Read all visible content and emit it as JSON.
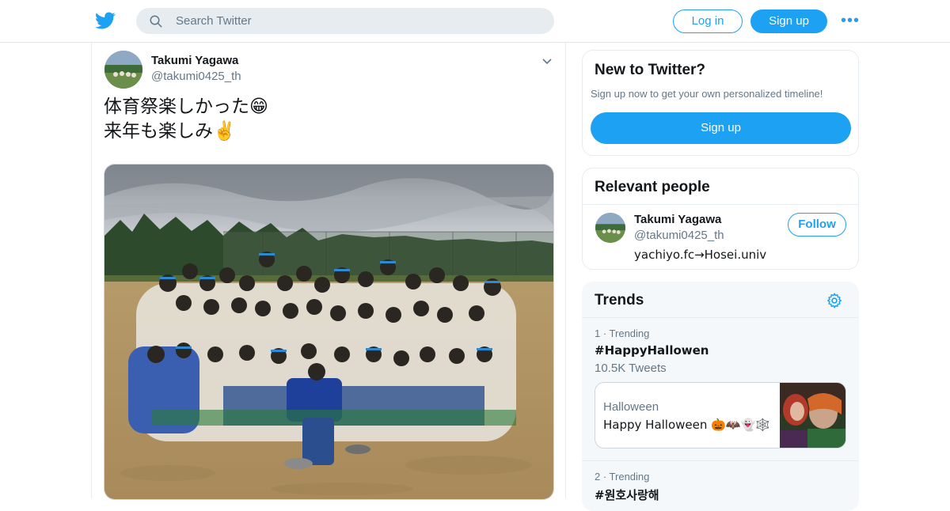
{
  "header": {
    "search_placeholder": "Search Twitter",
    "login_label": "Log in",
    "signup_label": "Sign up",
    "more_label": "•••",
    "brand_color": "#1da1f2"
  },
  "tweet": {
    "author_name": "Takumi Yagawa",
    "author_handle": "@takumi0425_th",
    "text_line1": "体育祭楽しかった😁",
    "text_line2": "来年も楽しみ✌️"
  },
  "sidebar": {
    "new_to_twitter": {
      "title": "New to Twitter?",
      "subtitle": "Sign up now to get your own personalized timeline!",
      "button_label": "Sign up"
    },
    "relevant_people": {
      "title": "Relevant people",
      "person": {
        "name": "Takumi Yagawa",
        "handle": "@takumi0425_th",
        "bio": "yachiyo.fc→Hosei.univ",
        "follow_label": "Follow"
      }
    },
    "trends": {
      "title": "Trends",
      "items": [
        {
          "meta": "1 · Trending",
          "name": "#HappyHallowen",
          "count": "10.5K Tweets",
          "event": {
            "category": "Halloween",
            "title": "Happy Halloween 🎃🦇👻🕸️"
          }
        },
        {
          "meta": "2 · Trending",
          "name": "#원호사랑해"
        }
      ]
    }
  }
}
